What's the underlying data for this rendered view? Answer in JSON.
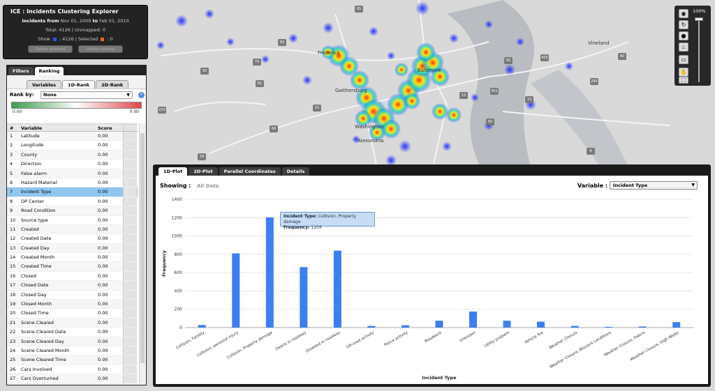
{
  "info": {
    "title": "ICE : Incidents Clustering Explorer",
    "range_prefix": "Incidents from",
    "range_from": "Nov 01, 2009",
    "range_to_word": "to",
    "range_to": "Feb 01, 2010",
    "totals": "Total: 4126 | Unmapped: 0",
    "show_label": "Show",
    "show_count": ": 4126 | Selected",
    "selected_count": ": 0",
    "delete_selected": "Delete selected",
    "delete_inverse": "Delete inverse",
    "colors": {
      "show": "#2255ee",
      "selected": "#ee6622"
    }
  },
  "map": {
    "labels": [
      "Frederick",
      "Gaithersburg",
      "Baltimore",
      "Washington",
      "Alexandria",
      "Vineland"
    ],
    "shields": [
      "83",
      "95",
      "70",
      "50",
      "81",
      "220",
      "15",
      "66",
      "29",
      "13",
      "9",
      "40",
      "295",
      "301",
      "50",
      "50",
      "405",
      "13"
    ]
  },
  "left": {
    "tabs": [
      "Filters",
      "Ranking"
    ],
    "subtabs": [
      "Variables",
      "1D-Rank",
      "2D-Rank"
    ],
    "rank_by_label": "Rank by:",
    "rank_by_value": "None",
    "grad_min": "0.00",
    "grad_max": "0.00",
    "headers": [
      "#",
      "Variable",
      "Score"
    ],
    "rows": [
      {
        "n": "1",
        "name": "Latitude",
        "score": "0.00"
      },
      {
        "n": "2",
        "name": "Longitude",
        "score": "0.00"
      },
      {
        "n": "3",
        "name": "County",
        "score": "0.00"
      },
      {
        "n": "4",
        "name": "Direction",
        "score": "0.00"
      },
      {
        "n": "5",
        "name": "False alarm",
        "score": "0.00"
      },
      {
        "n": "6",
        "name": "Hazard Material",
        "score": "0.00"
      },
      {
        "n": "7",
        "name": "Incident Type",
        "score": "0.00"
      },
      {
        "n": "8",
        "name": "OP Center",
        "score": "0.00"
      },
      {
        "n": "9",
        "name": "Road Condition",
        "score": "0.00"
      },
      {
        "n": "10",
        "name": "Source type",
        "score": "0.00"
      },
      {
        "n": "11",
        "name": "Created",
        "score": "0.00"
      },
      {
        "n": "12",
        "name": "Created Date",
        "score": "0.00"
      },
      {
        "n": "13",
        "name": "Created Day",
        "score": "0.00"
      },
      {
        "n": "14",
        "name": "Created Month",
        "score": "0.00"
      },
      {
        "n": "15",
        "name": "Created Time",
        "score": "0.00"
      },
      {
        "n": "16",
        "name": "Closed",
        "score": "0.00"
      },
      {
        "n": "17",
        "name": "Closed Date",
        "score": "0.00"
      },
      {
        "n": "18",
        "name": "Closed Day",
        "score": "0.00"
      },
      {
        "n": "19",
        "name": "Closed Month",
        "score": "0.00"
      },
      {
        "n": "20",
        "name": "Closed Time",
        "score": "0.00"
      },
      {
        "n": "21",
        "name": "Scene Cleared",
        "score": "0.00"
      },
      {
        "n": "22",
        "name": "Scene Cleared Date",
        "score": "0.00"
      },
      {
        "n": "23",
        "name": "Scene Cleared Day",
        "score": "0.00"
      },
      {
        "n": "24",
        "name": "Scene Cleared Month",
        "score": "0.00"
      },
      {
        "n": "25",
        "name": "Scene Cleared Time",
        "score": "0.00"
      },
      {
        "n": "26",
        "name": "Cars Involved",
        "score": "0.00"
      },
      {
        "n": "27",
        "name": "Cars Overturned",
        "score": "0.00"
      }
    ],
    "selected_row": 6
  },
  "tools": {
    "zoom_label": "100%"
  },
  "plot": {
    "tabs": [
      "1D-Plot",
      "2D-Plot",
      "Parallel Coordinates",
      "Details"
    ],
    "showing_label": "Showing :",
    "showing_value": "All Data",
    "variable_label": "Variable :",
    "variable_value": "Incident Type",
    "tooltip_type_label": "Incident Type:",
    "tooltip_type_value": "Collision, Property damage",
    "tooltip_freq_label": "Frequency:",
    "tooltip_freq_value": "1204"
  },
  "chart_data": {
    "type": "bar",
    "categories": [
      "Collision, Fatality",
      "Collision, personal injury",
      "Collision, Property damage",
      "Debris in roadway",
      "Disabled in roadway",
      "Off-road activity",
      "Police activity",
      "Roadwork",
      "Unknown",
      "Utility problem",
      "Vehicle fire",
      "Weather Closure",
      "Weather Closure, Blizzard conditions",
      "Weather Closure, Debris",
      "Weather Closure, High Water"
    ],
    "values": [
      28,
      810,
      1204,
      660,
      840,
      18,
      25,
      75,
      175,
      75,
      65,
      18,
      8,
      12,
      60
    ],
    "xlabel": "Incident Type",
    "ylabel": "Frequency",
    "ylim": [
      0,
      1400
    ],
    "yticks": [
      0,
      200,
      400,
      600,
      800,
      1000,
      1200,
      1400
    ],
    "grid": true,
    "color": "#3d7ef0"
  }
}
